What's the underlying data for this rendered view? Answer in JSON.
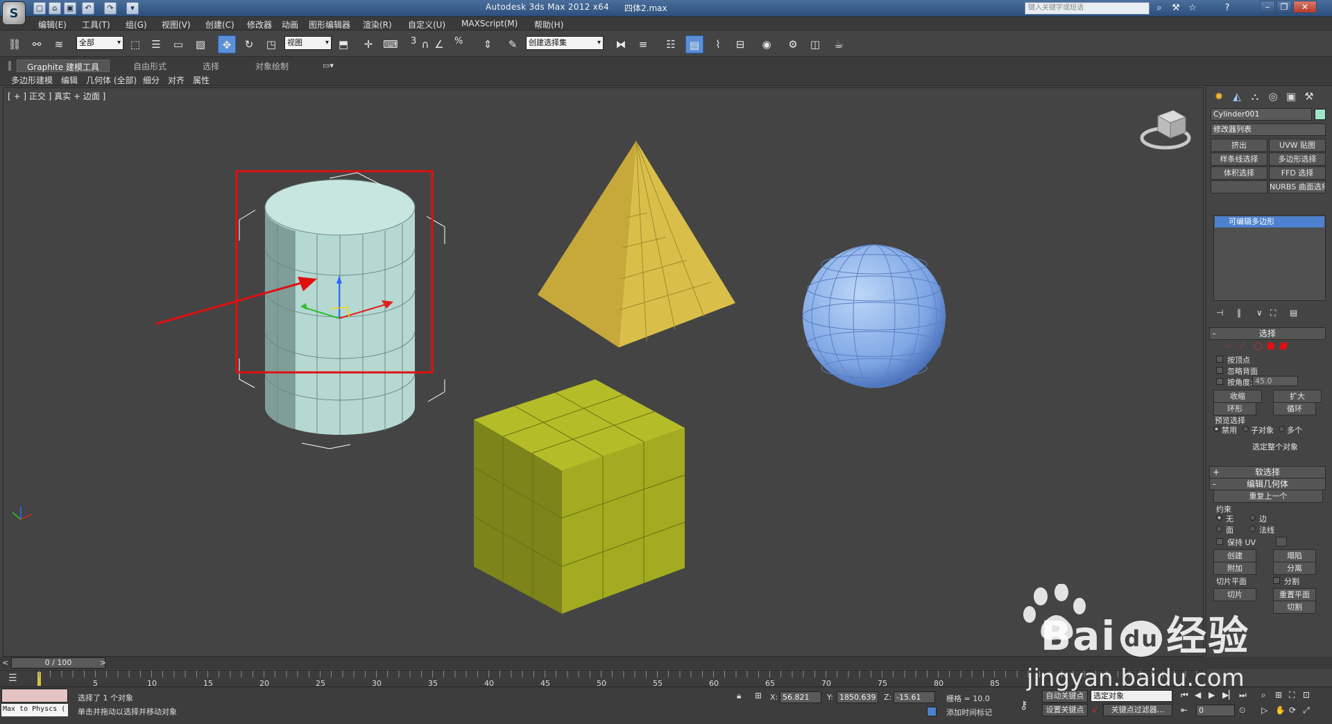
{
  "title_bar": {
    "app_title": "Autodesk 3ds Max  2012 x64",
    "filename": "四体2.max",
    "search_placeholder": "键入关键字或短语"
  },
  "menu": [
    "编辑(E)",
    "工具(T)",
    "组(G)",
    "视图(V)",
    "创建(C)",
    "修改器",
    "动画",
    "图形编辑器",
    "渲染(R)",
    "自定义(U)",
    "MAXScript(M)",
    "帮助(H)"
  ],
  "toolbar": {
    "selection_filter": "全部",
    "ref_coord": "视图",
    "named_selection": "创建选择集",
    "snap_3": "3",
    "snap_pct": "%"
  },
  "ribbon": {
    "tabs": [
      "Graphite 建模工具",
      "自由形式",
      "选择",
      "对象绘制"
    ],
    "sub_items": [
      "多边形建模",
      "编辑",
      "几何体 (全部)",
      "细分",
      "对齐",
      "属性"
    ]
  },
  "viewport": {
    "label": "[ + ] 正交 ] 真实 + 边面 ]"
  },
  "command_panel": {
    "object_name": "Cylinder001",
    "modifier_list": "修改器列表",
    "modifier_buttons": [
      "挤出",
      "UVW 贴图",
      "样条线选择",
      "多边形选择",
      "体积选择",
      "FFD 选择",
      "",
      "NURBS 曲面选择"
    ],
    "stack_item": "可编辑多边形",
    "select_rollout": "选择",
    "by_vertex": "按顶点",
    "ignore_backfacing": "忽略背面",
    "by_angle": "按角度:",
    "angle_value": "45.0",
    "shrink": "收缩",
    "grow": "扩大",
    "ring": "环形",
    "loop": "循环",
    "preview_selection": "预览选择",
    "preview_options": [
      "禁用",
      "子对象",
      "多个"
    ],
    "select_whole": "选定整个对象",
    "soft_selection": "软选择",
    "edit_geometry": "编辑几何体",
    "repeat_last": "重复上一个",
    "constraints": "约束",
    "constraint_options": [
      "无",
      "边",
      "面",
      "法线"
    ],
    "preserve_uv": "保持 UV",
    "create": "创建",
    "collapse": "塌陷",
    "attach": "附加",
    "detach": "分离",
    "slice_plane": "切片平面",
    "split": "分割",
    "slice": "切片",
    "reset_plane": "重置平面",
    "cut": "切割"
  },
  "timeline": {
    "frame_display": "0 / 100",
    "ticks": [
      "0",
      "5",
      "10",
      "15",
      "20",
      "25",
      "30",
      "35",
      "40",
      "45",
      "50",
      "55",
      "60",
      "65",
      "70",
      "75",
      "80",
      "85"
    ]
  },
  "status": {
    "maxscript": "Max to Physcs (",
    "selected": "选择了 1 个对象",
    "prompt": "单击并拖动以选择并移动对象",
    "x_label": "X:",
    "x_value": "56.821",
    "y_label": "Y:",
    "y_value": "1850.639",
    "z_label": "Z:",
    "z_value": "-15.61",
    "grid": "栅格 = 10.0",
    "add_time_tag": "添加时间标记",
    "auto_key": "自动关键点",
    "set_key": "设置关键点",
    "selected_object": "选定对象",
    "key_filters": "关键点过滤器...",
    "current_frame": "0"
  },
  "watermark": {
    "brand": "Bai",
    "brand_cn": "经验",
    "url": "jingyan.baidu.com"
  },
  "colors": {
    "selection_red": "#e01010",
    "cylinder": "#b8dcd6",
    "pyramid": "#c7a83a",
    "cube": "#a8b01c",
    "sphere": "#8fb6ec",
    "active_blue": "#4c82cf"
  }
}
